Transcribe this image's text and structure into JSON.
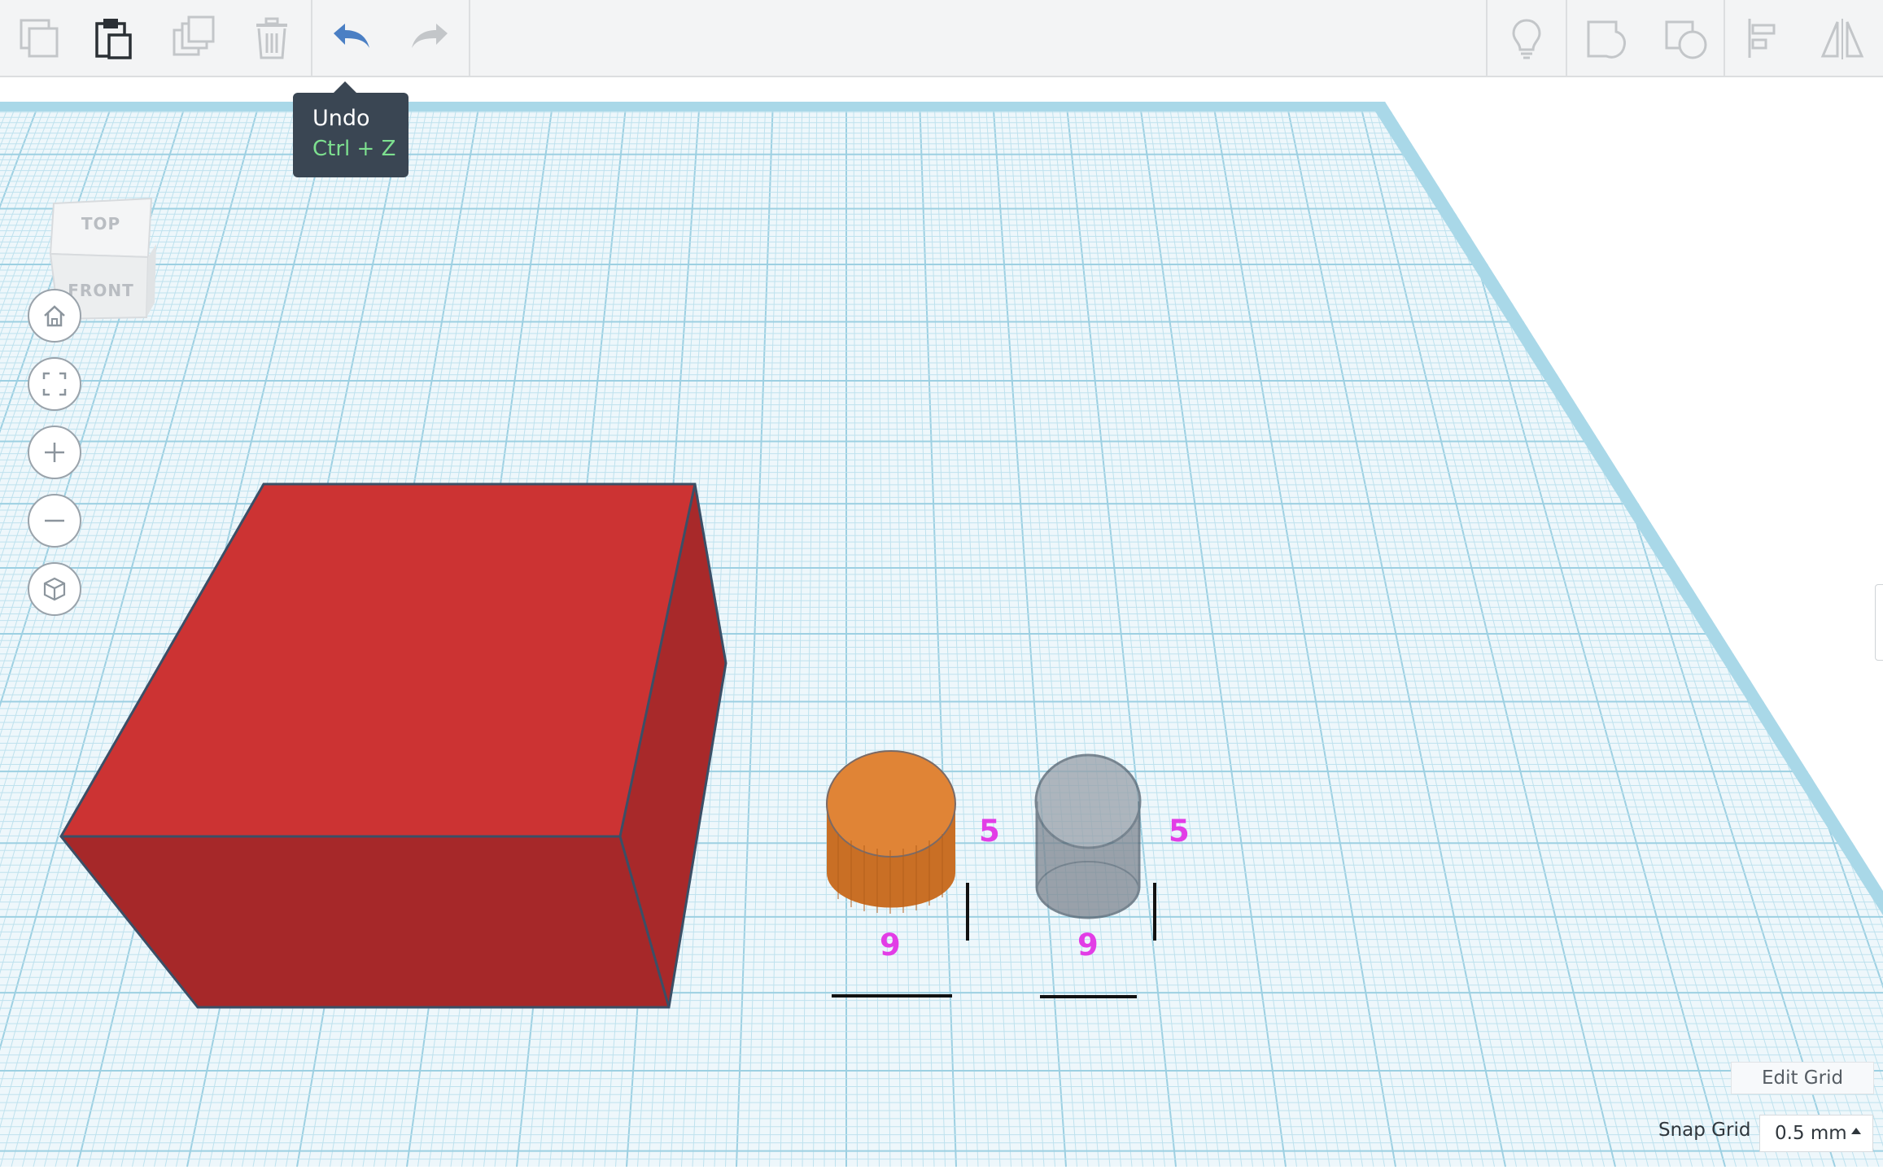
{
  "toolbar": {
    "left_tools": [
      {
        "icon": "copy-icon",
        "enabled": false
      },
      {
        "icon": "paste-icon",
        "enabled": true
      },
      {
        "icon": "duplicate-icon",
        "enabled": false
      },
      {
        "icon": "delete-icon",
        "enabled": false
      },
      {
        "icon": "undo-icon",
        "enabled": true
      },
      {
        "icon": "redo-icon",
        "enabled": false
      }
    ],
    "right_tools": [
      {
        "icon": "lightbulb-icon"
      },
      {
        "icon": "group-icon"
      },
      {
        "icon": "ungroup-icon"
      },
      {
        "icon": "align-icon"
      },
      {
        "icon": "mirror-icon"
      }
    ]
  },
  "tooltip": {
    "title": "Undo",
    "shortcut": "Ctrl + Z"
  },
  "view_cube": {
    "top_label": "TOP",
    "front_label": "FRONT"
  },
  "nav_buttons": [
    "home-icon",
    "fit-view-icon",
    "zoom-in-icon",
    "zoom-out-icon",
    "perspective-icon"
  ],
  "shapes": [
    {
      "name": "red-box",
      "color": "#cc3333"
    },
    {
      "name": "orange-cylinder",
      "color": "#e08436",
      "diameter": "9",
      "height": "5"
    },
    {
      "name": "hole-cylinder",
      "color": "#8d949c",
      "diameter": "9",
      "height": "5"
    }
  ],
  "colors": {
    "grid_line": "#bfe2ee",
    "grid_major": "#9dd0e2",
    "dimension_text": "#e23de6"
  },
  "bottom": {
    "edit_grid_label": "Edit Grid",
    "snap_grid_label": "Snap Grid",
    "snap_grid_value": "0.5 mm"
  }
}
